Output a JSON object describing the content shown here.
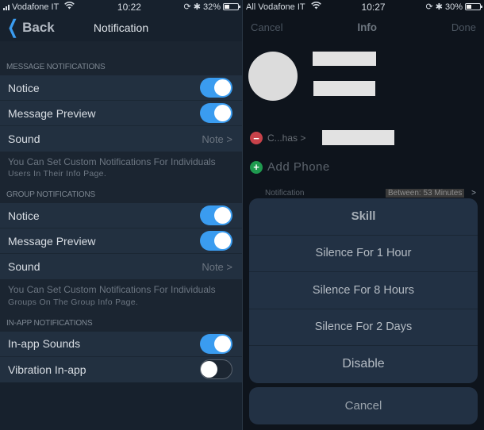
{
  "left": {
    "status": {
      "carrier": "Vodafone IT",
      "time": "10:22",
      "battery": "32%",
      "battery_level": 0.32
    },
    "nav": {
      "back_label": "Back",
      "title": "Notification"
    },
    "sections": [
      {
        "header": "MESSAGE NOTIFICATIONS",
        "rows": [
          {
            "label": "Notice",
            "type": "toggle",
            "on": true
          },
          {
            "label": "Message Preview",
            "type": "toggle",
            "on": true
          },
          {
            "label": "Sound",
            "type": "value",
            "value": "Note >"
          }
        ],
        "footer_line1": "You Can Set Custom Notifications For Individuals",
        "footer_line2": "Users In Their Info Page."
      },
      {
        "header": "GROUP NOTIFICATIONS",
        "rows": [
          {
            "label": "Notice",
            "type": "toggle",
            "on": true
          },
          {
            "label": "Message Preview",
            "type": "toggle",
            "on": true
          },
          {
            "label": "Sound",
            "type": "value",
            "value": "Note >"
          }
        ],
        "footer_line1": "You Can Set Custom Notifications For Individuals",
        "footer_line2": "Groups On The Group Info Page."
      },
      {
        "header": "IN-APP NOTIFICATIONS",
        "rows": [
          {
            "label": "In-app Sounds",
            "type": "toggle",
            "on": true
          },
          {
            "label": "Vibration In-app",
            "type": "toggle",
            "on": false
          }
        ]
      }
    ]
  },
  "right": {
    "status": {
      "carrier": "All Vodafone IT",
      "time": "10:27",
      "battery": "30%",
      "battery_level": 0.3
    },
    "nav": {
      "cancel_label": "Cancel",
      "title": "Info",
      "done_label": "Done"
    },
    "contact": {
      "phone_label": "C...has >",
      "add_phone_label": "Add Phone"
    },
    "notification": {
      "label": "Notification",
      "value": "Between: 53 Minutes",
      "chevron": ">"
    },
    "action_sheet": {
      "title": "Skill",
      "options": [
        "Silence For 1 Hour",
        "Silence For 8 Hours",
        "Silence For 2 Days"
      ],
      "disable_label": "Disable",
      "cancel_label": "Cancel"
    }
  }
}
